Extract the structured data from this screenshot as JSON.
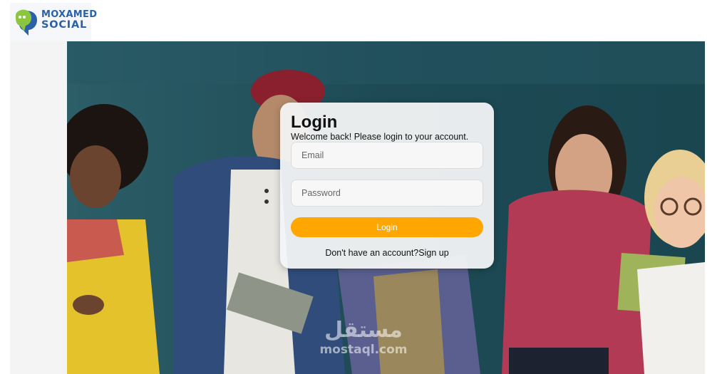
{
  "brand": {
    "line1": "MOXAMED",
    "line2": "SOCIAL",
    "icon": "speech-bubble-heads-icon"
  },
  "login": {
    "title": "Login",
    "subtitle": "Welcome back! Please login to your account.",
    "email_placeholder": "Email",
    "password_placeholder": "Password",
    "button_label": "Login",
    "signup_prompt": "Don't have an account?",
    "signup_link": "Sign up"
  },
  "watermark": {
    "arabic": "مستقل",
    "latin": "mostaql.com"
  },
  "colors": {
    "brand_blue": "#2a61a8",
    "brand_green": "#8cc63f",
    "button": "#ffa600",
    "hero_bg": "#1f4d57"
  }
}
